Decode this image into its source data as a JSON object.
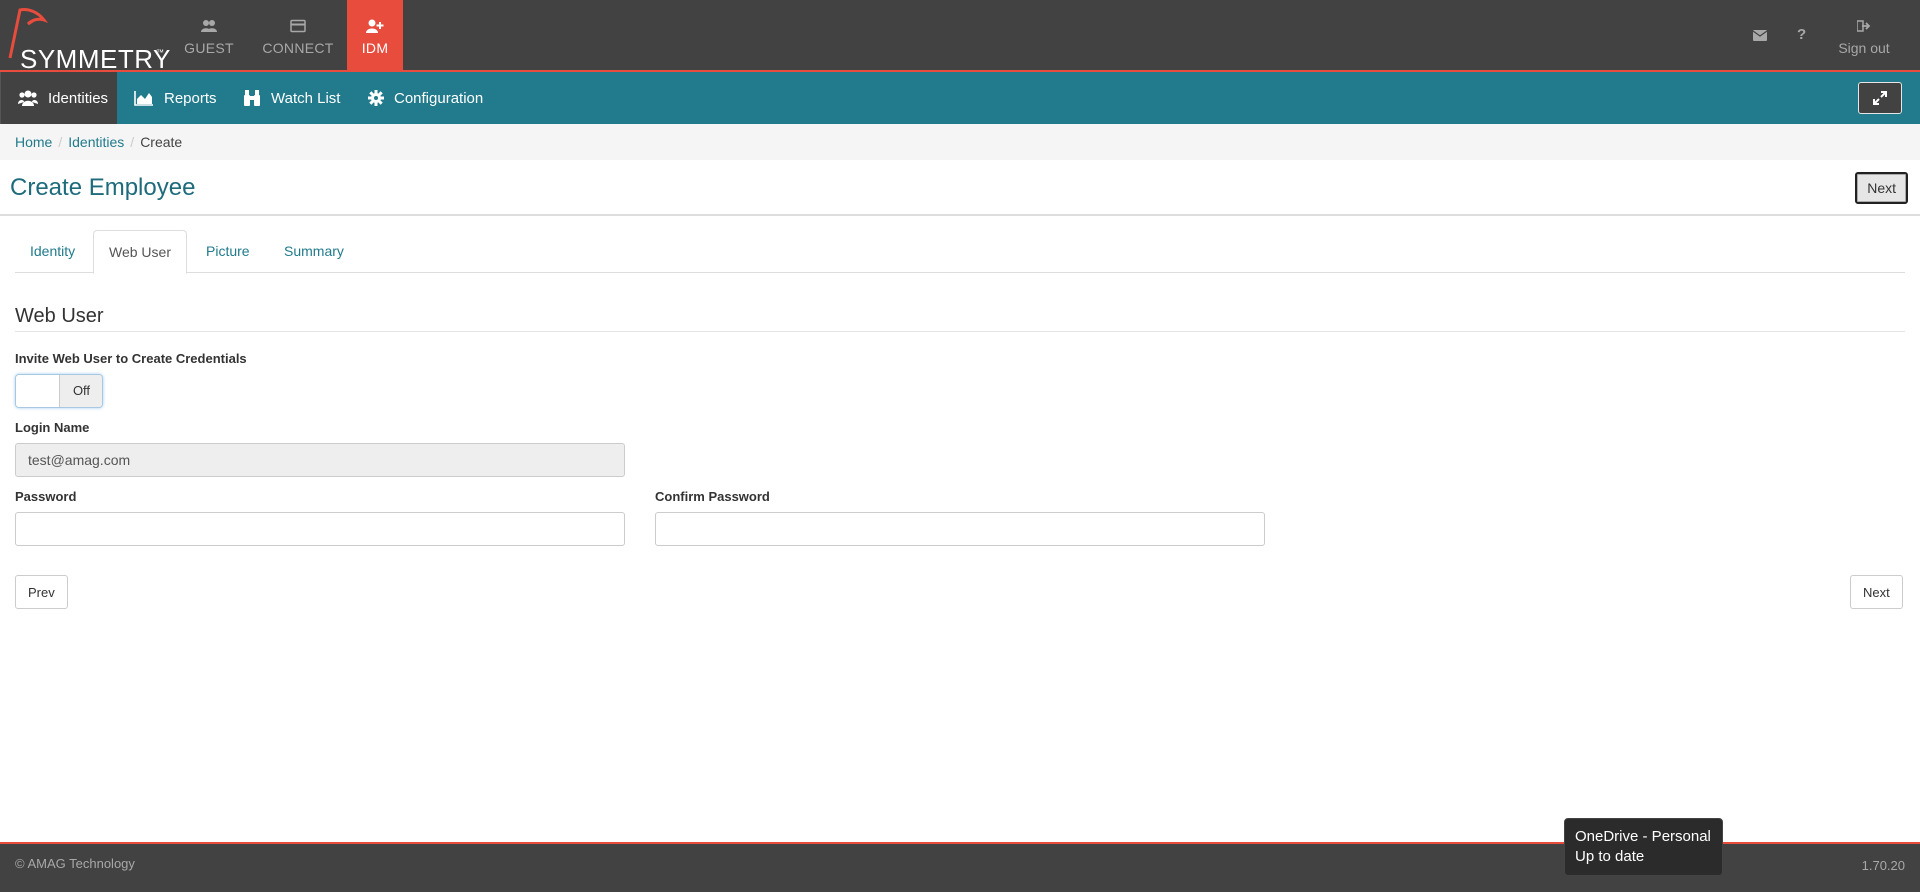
{
  "brand": {
    "name": "SYMMETRY",
    "tm": "™"
  },
  "apps": {
    "guest": "GUEST",
    "connect": "CONNECT",
    "idm": "IDM"
  },
  "top_actions": {
    "signout": "Sign out"
  },
  "nav": {
    "identities": "Identities",
    "reports": "Reports",
    "watch_list": "Watch List",
    "configuration": "Configuration"
  },
  "breadcrumb": {
    "home": "Home",
    "identities": "Identities",
    "current": "Create"
  },
  "page": {
    "title": "Create Employee",
    "next_top": "Next"
  },
  "tabs": [
    "Identity",
    "Web User",
    "Picture",
    "Summary"
  ],
  "form": {
    "section_title": "Web User",
    "invite_label": "Invite Web User to Create Credentials",
    "toggle_state": "Off",
    "login_label": "Login Name",
    "login_value": "test@amag.com",
    "password_label": "Password",
    "confirm_label": "Confirm Password",
    "prev_button": "Prev",
    "next_button": "Next"
  },
  "footer": {
    "copyright": "© AMAG Technology",
    "version": "1.70.20"
  },
  "toast": {
    "line1": "OneDrive - Personal",
    "line2": "Up to date"
  },
  "colors": {
    "accent": "#e74c3c",
    "nav": "#217b8c",
    "dark": "#424242"
  }
}
